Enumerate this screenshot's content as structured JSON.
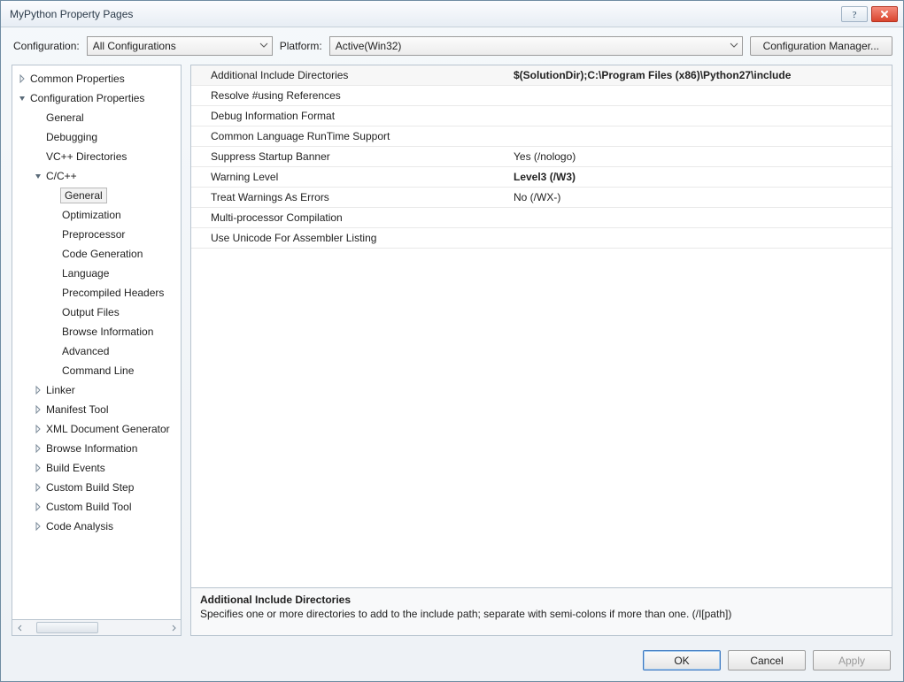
{
  "window": {
    "title": "MyPython Property Pages"
  },
  "config_bar": {
    "config_label": "Configuration:",
    "config_value": "All Configurations",
    "platform_label": "Platform:",
    "platform_value": "Active(Win32)",
    "manager_button": "Configuration Manager..."
  },
  "tree": [
    {
      "depth": 0,
      "state": "collapsed",
      "label": "Common Properties"
    },
    {
      "depth": 0,
      "state": "expanded",
      "label": "Configuration Properties"
    },
    {
      "depth": 1,
      "state": "none",
      "label": "General"
    },
    {
      "depth": 1,
      "state": "none",
      "label": "Debugging"
    },
    {
      "depth": 1,
      "state": "none",
      "label": "VC++ Directories"
    },
    {
      "depth": 1,
      "state": "expanded",
      "label": "C/C++"
    },
    {
      "depth": 2,
      "state": "none",
      "label": "General",
      "selected": true
    },
    {
      "depth": 2,
      "state": "none",
      "label": "Optimization"
    },
    {
      "depth": 2,
      "state": "none",
      "label": "Preprocessor"
    },
    {
      "depth": 2,
      "state": "none",
      "label": "Code Generation"
    },
    {
      "depth": 2,
      "state": "none",
      "label": "Language"
    },
    {
      "depth": 2,
      "state": "none",
      "label": "Precompiled Headers"
    },
    {
      "depth": 2,
      "state": "none",
      "label": "Output Files"
    },
    {
      "depth": 2,
      "state": "none",
      "label": "Browse Information"
    },
    {
      "depth": 2,
      "state": "none",
      "label": "Advanced"
    },
    {
      "depth": 2,
      "state": "none",
      "label": "Command Line"
    },
    {
      "depth": 1,
      "state": "collapsed",
      "label": "Linker"
    },
    {
      "depth": 1,
      "state": "collapsed",
      "label": "Manifest Tool"
    },
    {
      "depth": 1,
      "state": "collapsed",
      "label": "XML Document Generator"
    },
    {
      "depth": 1,
      "state": "collapsed",
      "label": "Browse Information"
    },
    {
      "depth": 1,
      "state": "collapsed",
      "label": "Build Events"
    },
    {
      "depth": 1,
      "state": "collapsed",
      "label": "Custom Build Step"
    },
    {
      "depth": 1,
      "state": "collapsed",
      "label": "Custom Build Tool"
    },
    {
      "depth": 1,
      "state": "collapsed",
      "label": "Code Analysis"
    }
  ],
  "properties": [
    {
      "name": "Additional Include Directories",
      "value": "$(SolutionDir);C:\\Program Files (x86)\\Python27\\include",
      "selected": true
    },
    {
      "name": "Resolve #using References",
      "value": ""
    },
    {
      "name": "Debug Information Format",
      "value": ""
    },
    {
      "name": "Common Language RunTime Support",
      "value": ""
    },
    {
      "name": "Suppress Startup Banner",
      "value": "Yes (/nologo)"
    },
    {
      "name": "Warning Level",
      "value": "Level3 (/W3)",
      "bold": true
    },
    {
      "name": "Treat Warnings As Errors",
      "value": "No (/WX-)"
    },
    {
      "name": "Multi-processor Compilation",
      "value": ""
    },
    {
      "name": "Use Unicode For Assembler Listing",
      "value": ""
    }
  ],
  "description": {
    "title": "Additional Include Directories",
    "text": "Specifies one or more directories to add to the include path; separate with semi-colons if more than one.     (/I[path])"
  },
  "footer": {
    "ok": "OK",
    "cancel": "Cancel",
    "apply": "Apply"
  }
}
